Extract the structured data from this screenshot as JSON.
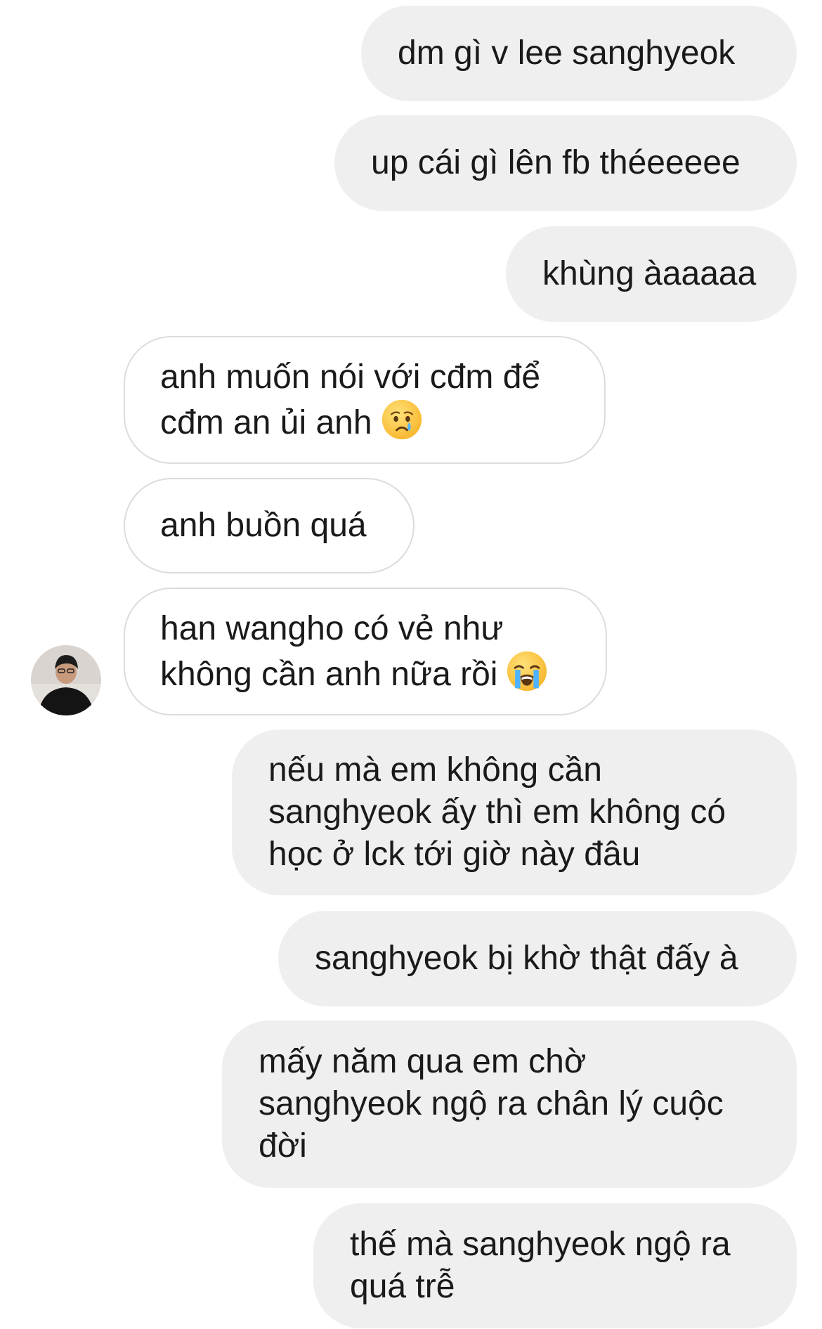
{
  "messages": [
    {
      "from": "me",
      "text": "dm gì v lee sanghyeok"
    },
    {
      "from": "me",
      "text": "up cái gì lên fb théeeeee"
    },
    {
      "from": "me",
      "text": "khùng àaaaaa"
    },
    {
      "from": "them",
      "text": "anh muốn nói với cđm để\ncđm an ủi anh",
      "emoji": "crying-face"
    },
    {
      "from": "them",
      "text": "anh buồn quá"
    },
    {
      "from": "them",
      "text": "han wangho có vẻ như\nkhông cần anh nữa rồi",
      "emoji": "loudly-crying-face"
    },
    {
      "from": "me",
      "text": "nếu mà em không cần\nsanghyeok ấy thì em không có\nhọc ở lck tới giờ này đâu"
    },
    {
      "from": "me",
      "text": "sanghyeok bị khờ thật đấy à"
    },
    {
      "from": "me",
      "text": "mấy năm qua em chờ\nsanghyeok ngộ ra chân lý cuộc\nđời"
    },
    {
      "from": "me",
      "text": "thế mà sanghyeok ngộ ra\nquá trễ"
    }
  ],
  "avatar": {
    "icon": "contact-avatar"
  },
  "colors": {
    "sent_bubble": "#efefef",
    "received_border": "#dcdcdc",
    "text": "#1a1a1a"
  }
}
